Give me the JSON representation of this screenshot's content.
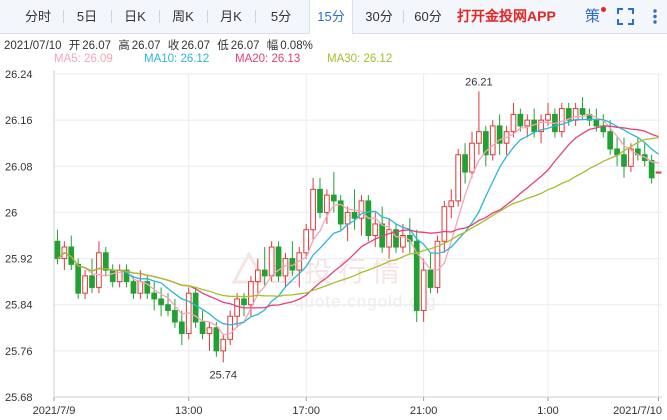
{
  "tabs": [
    {
      "label": "分时",
      "active": false
    },
    {
      "label": "5日",
      "active": false
    },
    {
      "label": "日K",
      "active": false
    },
    {
      "label": "周K",
      "active": false
    },
    {
      "label": "月K",
      "active": false
    },
    {
      "label": "5分",
      "active": false
    },
    {
      "label": "15分",
      "active": true
    },
    {
      "label": "30分",
      "active": false
    },
    {
      "label": "60分",
      "active": false
    }
  ],
  "app_link": "打开金投网APP",
  "ce_label": "策",
  "quote": {
    "date": "2021/07/10",
    "open_label": "开",
    "open": "26.07",
    "high_label": "高",
    "high": "26.07",
    "close_label": "收",
    "close": "26.07",
    "low_label": "低",
    "low": "26.07",
    "amp_label": "幅",
    "amp": "0.08%"
  },
  "ma_legend": [
    {
      "label": "MA5",
      "value": "26.09",
      "color": "#f4a6b8"
    },
    {
      "label": "MA10",
      "value": "26.12",
      "color": "#2ab8d6"
    },
    {
      "label": "MA20",
      "value": "26.13",
      "color": "#e4407d"
    },
    {
      "label": "MA30",
      "value": "26.12",
      "color": "#a8bd2c"
    }
  ],
  "watermark": {
    "name": "金投行情",
    "url": "quote.cngold.org"
  },
  "colors": {
    "up": "#e03a3a",
    "down": "#22a034",
    "grid": "#e8ecf1",
    "axis_text": "#333333"
  },
  "chart_data": {
    "type": "candlestick",
    "interval": "15分",
    "y_ticks": [
      "26.24",
      "26.16",
      "26.08",
      "26",
      "25.92",
      "25.84",
      "25.76",
      "25.68"
    ],
    "ylim": [
      25.68,
      26.24
    ],
    "x_tick_labels": [
      "2021/7/9",
      "13:00",
      "17:00",
      "21:00",
      "1:00",
      "2021/7/10"
    ],
    "x_tick_index": [
      0,
      19,
      36,
      53,
      71,
      87
    ],
    "annotations": [
      {
        "text": "26.21",
        "index": 61,
        "value": 26.21
      },
      {
        "text": "25.74",
        "index": 24,
        "value": 25.74
      }
    ],
    "candles": [
      [
        25.95,
        25.97,
        25.91,
        25.92
      ],
      [
        25.92,
        25.95,
        25.9,
        25.94
      ],
      [
        25.94,
        25.96,
        25.9,
        25.91
      ],
      [
        25.91,
        25.92,
        25.85,
        25.86
      ],
      [
        25.86,
        25.9,
        25.85,
        25.89
      ],
      [
        25.89,
        25.92,
        25.86,
        25.87
      ],
      [
        25.87,
        25.95,
        25.86,
        25.93
      ],
      [
        25.93,
        25.94,
        25.89,
        25.9
      ],
      [
        25.9,
        25.91,
        25.87,
        25.88
      ],
      [
        25.88,
        25.91,
        25.87,
        25.9
      ],
      [
        25.9,
        25.91,
        25.87,
        25.88
      ],
      [
        25.88,
        25.89,
        25.85,
        25.86
      ],
      [
        25.86,
        25.9,
        25.85,
        25.88
      ],
      [
        25.88,
        25.89,
        25.85,
        25.86
      ],
      [
        25.86,
        25.88,
        25.83,
        25.85
      ],
      [
        25.85,
        25.87,
        25.82,
        25.84
      ],
      [
        25.84,
        25.86,
        25.82,
        25.83
      ],
      [
        25.83,
        25.85,
        25.8,
        25.81
      ],
      [
        25.81,
        25.83,
        25.77,
        25.79
      ],
      [
        25.79,
        25.87,
        25.78,
        25.86
      ],
      [
        25.86,
        25.87,
        25.8,
        25.81
      ],
      [
        25.81,
        25.83,
        25.78,
        25.79
      ],
      [
        25.79,
        25.81,
        25.76,
        25.8
      ],
      [
        25.8,
        25.81,
        25.75,
        25.76
      ],
      [
        25.76,
        25.79,
        25.74,
        25.78
      ],
      [
        25.78,
        25.83,
        25.77,
        25.82
      ],
      [
        25.82,
        25.86,
        25.8,
        25.85
      ],
      [
        25.85,
        25.86,
        25.82,
        25.84
      ],
      [
        25.84,
        25.89,
        25.82,
        25.88
      ],
      [
        25.88,
        25.92,
        25.86,
        25.9
      ],
      [
        25.9,
        25.94,
        25.87,
        25.89
      ],
      [
        25.89,
        25.95,
        25.88,
        25.94
      ],
      [
        25.94,
        25.95,
        25.88,
        25.89
      ],
      [
        25.89,
        25.93,
        25.87,
        25.92
      ],
      [
        25.92,
        25.95,
        25.89,
        25.9
      ],
      [
        25.9,
        25.94,
        25.87,
        25.93
      ],
      [
        25.93,
        25.98,
        25.92,
        25.97
      ],
      [
        25.97,
        26.06,
        25.95,
        26.04
      ],
      [
        26.04,
        26.06,
        25.99,
        26.0
      ],
      [
        26.0,
        26.04,
        25.98,
        26.03
      ],
      [
        26.03,
        26.07,
        26.0,
        26.02
      ],
      [
        26.02,
        26.03,
        25.97,
        25.98
      ],
      [
        25.98,
        26.01,
        25.95,
        26.0
      ],
      [
        26.0,
        26.04,
        25.97,
        25.99
      ],
      [
        25.99,
        26.03,
        25.96,
        26.02
      ],
      [
        26.02,
        26.03,
        25.95,
        25.96
      ],
      [
        25.96,
        26.0,
        25.94,
        25.98
      ],
      [
        25.98,
        26.01,
        25.93,
        25.94
      ],
      [
        25.94,
        25.99,
        25.92,
        25.97
      ],
      [
        25.97,
        25.98,
        25.93,
        25.94
      ],
      [
        25.94,
        25.98,
        25.93,
        25.96
      ],
      [
        25.96,
        25.99,
        25.93,
        25.95
      ],
      [
        25.95,
        25.97,
        25.81,
        25.83
      ],
      [
        25.83,
        25.92,
        25.81,
        25.9
      ],
      [
        25.9,
        25.93,
        25.86,
        25.87
      ],
      [
        25.87,
        25.96,
        25.86,
        25.95
      ],
      [
        25.95,
        26.02,
        25.93,
        26.01
      ],
      [
        26.01,
        26.04,
        25.99,
        26.02
      ],
      [
        26.02,
        26.11,
        26.01,
        26.1
      ],
      [
        26.1,
        26.12,
        26.05,
        26.07
      ],
      [
        26.07,
        26.14,
        26.06,
        26.12
      ],
      [
        26.12,
        26.21,
        26.1,
        26.14
      ],
      [
        26.14,
        26.15,
        26.08,
        26.1
      ],
      [
        26.1,
        26.16,
        26.09,
        26.15
      ],
      [
        26.15,
        26.17,
        26.1,
        26.12
      ],
      [
        26.12,
        26.15,
        26.1,
        26.14
      ],
      [
        26.14,
        26.19,
        26.13,
        26.17
      ],
      [
        26.17,
        26.18,
        26.14,
        26.15
      ],
      [
        26.15,
        26.17,
        26.13,
        26.16
      ],
      [
        26.16,
        26.18,
        26.13,
        26.14
      ],
      [
        26.14,
        26.17,
        26.12,
        26.16
      ],
      [
        26.16,
        26.19,
        26.15,
        26.17
      ],
      [
        26.17,
        26.18,
        26.13,
        26.14
      ],
      [
        26.14,
        26.19,
        26.13,
        26.18
      ],
      [
        26.18,
        26.19,
        26.15,
        26.16
      ],
      [
        26.16,
        26.19,
        26.15,
        26.18
      ],
      [
        26.18,
        26.2,
        26.16,
        26.17
      ],
      [
        26.17,
        26.18,
        26.15,
        26.16
      ],
      [
        26.16,
        26.18,
        26.14,
        26.15
      ],
      [
        26.15,
        26.17,
        26.13,
        26.14
      ],
      [
        26.14,
        26.16,
        26.1,
        26.11
      ],
      [
        26.11,
        26.13,
        26.08,
        26.1
      ],
      [
        26.1,
        26.13,
        26.06,
        26.08
      ],
      [
        26.08,
        26.12,
        26.07,
        26.11
      ],
      [
        26.11,
        26.13,
        26.09,
        26.1
      ],
      [
        26.1,
        26.12,
        26.08,
        26.09
      ],
      [
        26.09,
        26.1,
        26.05,
        26.06
      ],
      [
        26.07,
        26.07,
        26.07,
        26.07
      ]
    ]
  }
}
